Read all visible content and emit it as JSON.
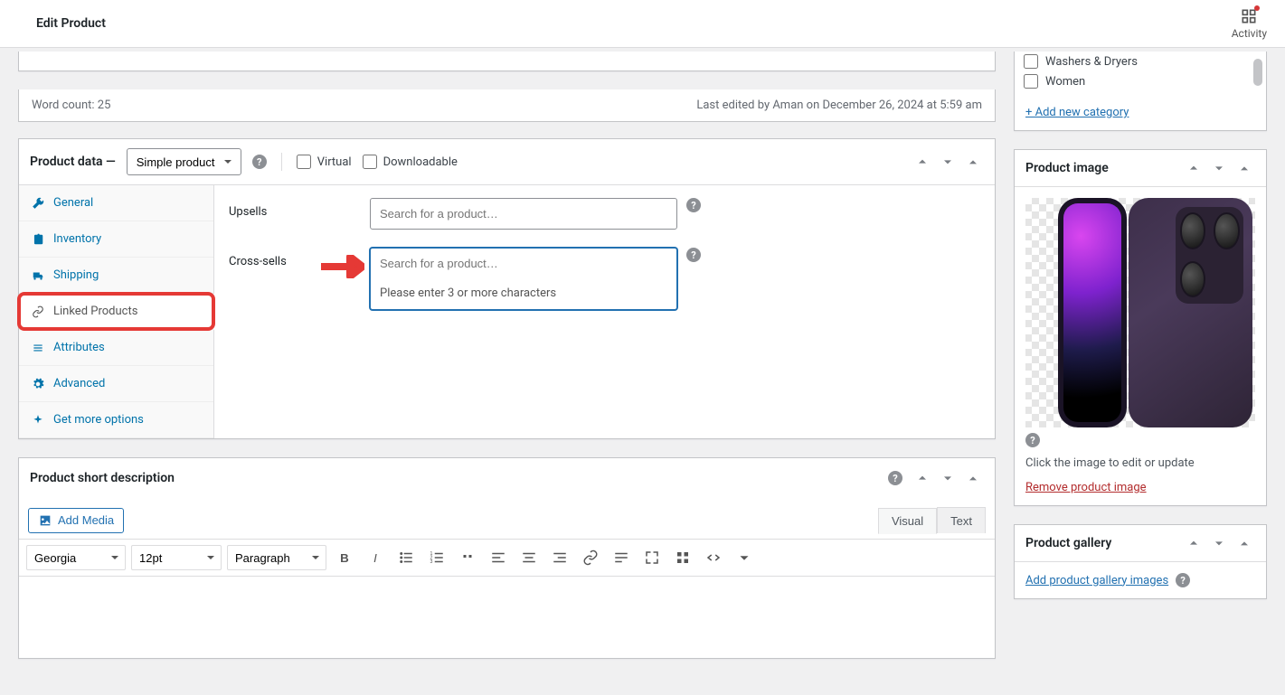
{
  "header": {
    "title": "Edit Product",
    "activity": "Activity"
  },
  "editor_meta": {
    "word_count": "Word count: 25",
    "last_edited": "Last edited by Aman on December 26, 2024 at 5:59 am"
  },
  "product_data": {
    "title": "Product data —",
    "type_selected": "Simple product",
    "virtual": "Virtual",
    "downloadable": "Downloadable",
    "tabs": {
      "general": "General",
      "inventory": "Inventory",
      "shipping": "Shipping",
      "linked": "Linked Products",
      "attributes": "Attributes",
      "advanced": "Advanced",
      "more": "Get more options"
    },
    "linked": {
      "upsells_label": "Upsells",
      "upsells_placeholder": "Search for a product…",
      "crosssells_label": "Cross-sells",
      "crosssells_placeholder": "Search for a product…",
      "search_hint": "Please enter 3 or more characters"
    }
  },
  "short_desc": {
    "title": "Product short description",
    "add_media": "Add Media",
    "tabs": {
      "visual": "Visual",
      "text": "Text"
    },
    "toolbar": {
      "font": "Georgia",
      "size": "12pt",
      "format": "Paragraph"
    }
  },
  "categories": {
    "items": [
      "Washers & Dryers",
      "Women"
    ],
    "add_new": "+ Add new category"
  },
  "product_image": {
    "title": "Product image",
    "click_text": "Click the image to edit or update",
    "remove_text": "Remove product image"
  },
  "product_gallery": {
    "title": "Product gallery",
    "add_link": "Add product gallery images"
  }
}
